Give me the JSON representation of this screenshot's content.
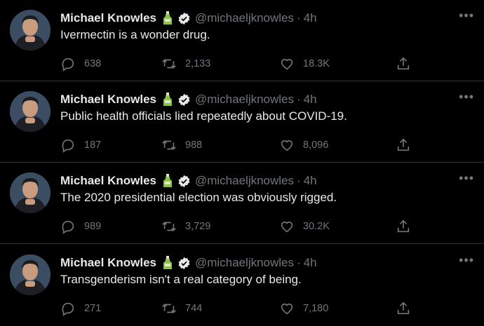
{
  "tweets": [
    {
      "name": "Michael Knowles",
      "handle": "@michaeljknowles",
      "separator": "·",
      "time": "4h",
      "text": "Ivermectin is a wonder drug.",
      "replies": "638",
      "retweets": "2,133",
      "likes": "18.3K"
    },
    {
      "name": "Michael Knowles",
      "handle": "@michaeljknowles",
      "separator": "·",
      "time": "4h",
      "text": "Public health officials lied repeatedly about COVID-19.",
      "replies": "187",
      "retweets": "988",
      "likes": "8,096"
    },
    {
      "name": "Michael Knowles",
      "handle": "@michaeljknowles",
      "separator": "·",
      "time": "4h",
      "text": "The 2020 presidential election was obviously rigged.",
      "replies": "989",
      "retweets": "3,729",
      "likes": "30.2K"
    },
    {
      "name": "Michael Knowles",
      "handle": "@michaeljknowles",
      "separator": "·",
      "time": "4h",
      "text": "Transgenderism isn't a real category of being.",
      "replies": "271",
      "retweets": "744",
      "likes": "7,180"
    }
  ],
  "icons": {
    "more": "more-options-icon",
    "reply": "reply-icon",
    "retweet": "retweet-icon",
    "like": "like-icon",
    "share": "share-icon",
    "verified": "verified-badge-icon",
    "emoji": "bottle-emoji-icon"
  },
  "colors": {
    "background": "#000000",
    "text": "#e7e9ea",
    "muted": "#71767b",
    "divider": "#2f3336"
  }
}
